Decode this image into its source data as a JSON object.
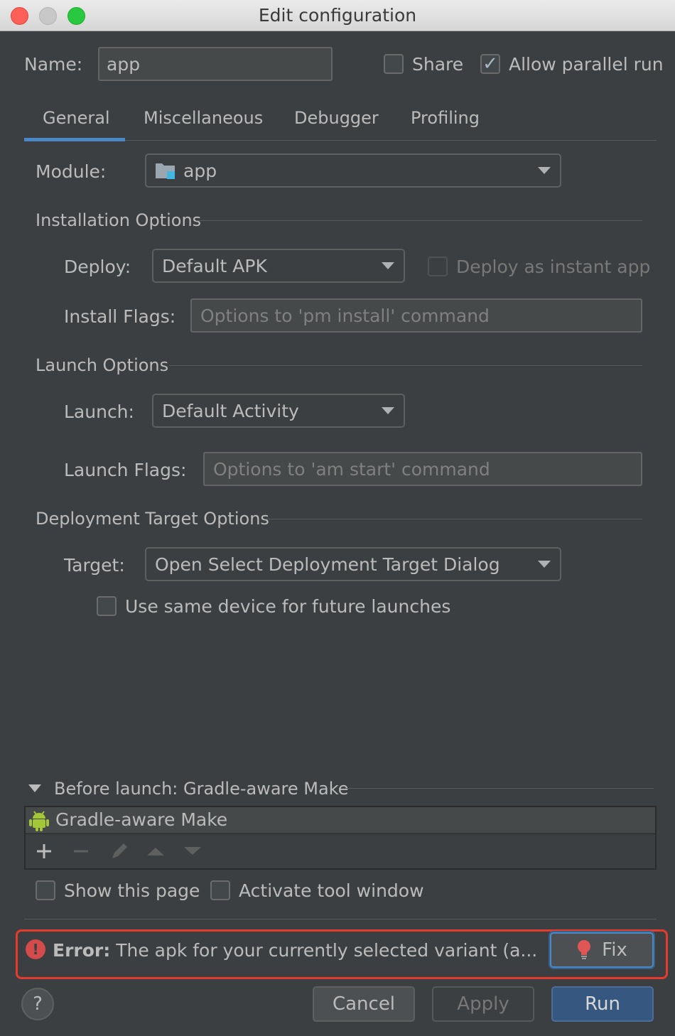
{
  "window": {
    "title": "Edit configuration"
  },
  "header": {
    "name_label": "Name:",
    "name_value": "app",
    "share_label": "Share",
    "share_checked": false,
    "parallel_label": "Allow parallel run",
    "parallel_checked": true
  },
  "tabs": [
    {
      "label": "General",
      "active": true
    },
    {
      "label": "Miscellaneous",
      "active": false
    },
    {
      "label": "Debugger",
      "active": false
    },
    {
      "label": "Profiling",
      "active": false
    }
  ],
  "module": {
    "label": "Module:",
    "value": "app",
    "icon": "module-folder-icon"
  },
  "installation": {
    "section_title": "Installation Options",
    "deploy_label": "Deploy:",
    "deploy_value": "Default APK",
    "instant_label": "Deploy as instant app",
    "instant_checked": false,
    "flags_label": "Install Flags:",
    "flags_placeholder": "Options to 'pm install' command"
  },
  "launch": {
    "section_title": "Launch Options",
    "launch_label": "Launch:",
    "launch_value": "Default Activity",
    "flags_label": "Launch Flags:",
    "flags_placeholder": "Options to 'am start' command"
  },
  "deployment": {
    "section_title": "Deployment Target Options",
    "target_label": "Target:",
    "target_value": "Open Select Deployment Target Dialog",
    "same_device_label": "Use same device for future launches",
    "same_device_checked": false
  },
  "before_launch": {
    "title": "Before launch: Gradle-aware Make",
    "items": [
      {
        "label": "Gradle-aware Make",
        "icon": "android-icon"
      }
    ],
    "toolbar_icons": [
      "add-icon",
      "remove-icon",
      "edit-icon",
      "move-up-icon",
      "move-down-icon"
    ]
  },
  "options": {
    "show_page_label": "Show this page",
    "show_page_checked": false,
    "activate_tool_label": "Activate tool window",
    "activate_tool_checked": false
  },
  "error": {
    "prefix": "Error:",
    "message": " The apk for your currently selected variant (a...",
    "fix_label": "Fix",
    "color": "#e43b2e"
  },
  "footer": {
    "help_label": "?",
    "cancel_label": "Cancel",
    "apply_label": "Apply",
    "run_label": "Run"
  },
  "colors": {
    "background": "#3c3f41",
    "accent": "#4a88c7",
    "primary_button": "#365880",
    "highlight_border": "#e43b2e"
  }
}
